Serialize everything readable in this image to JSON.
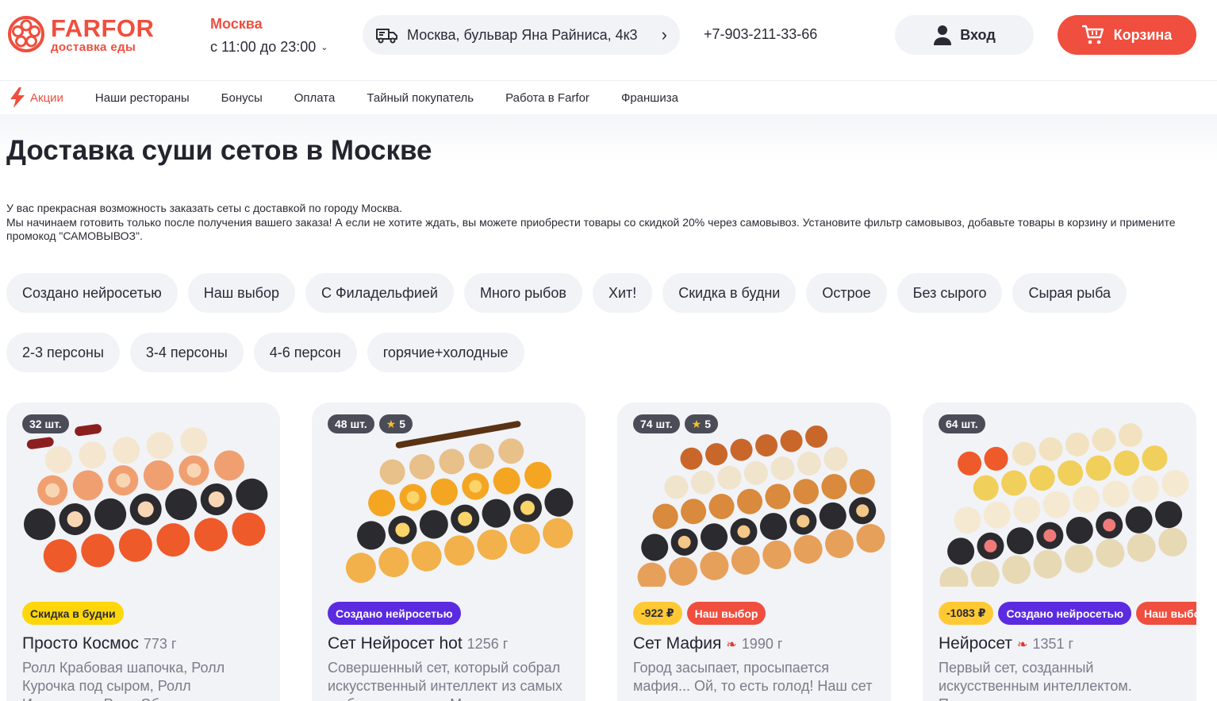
{
  "header": {
    "logo_name": "FARFOR",
    "logo_sub": "доставка еды",
    "city": "Москва",
    "hours": "с 11:00 до 23:00",
    "address": "Москва, бульвар Яна Райниса, 4к3",
    "phone": "+7-903-211-33-66",
    "login_label": "Вход",
    "cart_label": "Корзина",
    "accent_color": "#f04e3e"
  },
  "nav": {
    "items": [
      "Акции",
      "Наши рестораны",
      "Бонусы",
      "Оплата",
      "Тайный покупатель",
      "Работа в Farfor",
      "Франшиза"
    ]
  },
  "main": {
    "title": "Доставка суши сетов в Москве",
    "description_line1": "У вас прекрасная возможность заказать сеты с доставкой по городу Москва.",
    "description_line2": "Мы начинаем готовить только после получения вашего заказа! А если не хотите ждать, вы можете приобрести товары со скидкой 20% через самовывоз. Установите фильтр самовывоз, добавьте товары в корзину и примените промокод \"САМОВЫВОЗ\".",
    "filters_row1": [
      "Создано нейросетью",
      "Наш выбор",
      "С Филадельфией",
      "Много рыбов",
      "Хит!",
      "Скидка в будни",
      "Острое",
      "Без сырого",
      "Сырая рыба"
    ],
    "filters_row2": [
      "2-3 персоны",
      "3-4 персоны",
      "4-6 персон",
      "горячие+холодные"
    ]
  },
  "cards": [
    {
      "count": "32 шт.",
      "rating": "",
      "tags": [
        {
          "text": "Скидка в будни",
          "style": "yellow"
        }
      ],
      "name": "Просто Космос",
      "spicy": false,
      "weight": "773 г",
      "desc": "Ролл Крабовая шапочка, Ролл Курочка под сыром, Ролл Император, Ролл Эби шрим"
    },
    {
      "count": "48 шт.",
      "rating": "5",
      "tags": [
        {
          "text": "Создано нейросетью",
          "style": "purple"
        }
      ],
      "name": "Сет Нейросет hot",
      "spicy": false,
      "weight": "1256 г",
      "desc": "Совершенный сет, который собрал искусственный интеллект из самых любимых роллов. Мы"
    },
    {
      "count": "74 шт.",
      "rating": "5",
      "tags": [
        {
          "text": "-922 ₽",
          "style": "price"
        },
        {
          "text": "Наш выбор",
          "style": "red"
        }
      ],
      "name": "Сет Мафия",
      "spicy": true,
      "weight": "1990 г",
      "desc": "Город засыпает, просыпается мафия... Ой, то есть голод! Наш сет не оставит вам ни единого"
    },
    {
      "count": "64 шт.",
      "rating": "",
      "tags": [
        {
          "text": "-1083 ₽",
          "style": "price"
        },
        {
          "text": "Создано нейросетью",
          "style": "purple"
        },
        {
          "text": "Наш выбор",
          "style": "red"
        }
      ],
      "name": "Нейросет",
      "spicy": true,
      "weight": "1351 г",
      "desc": "Первый сет, созданный искусственным интеллектом. Проанализировав ваши"
    }
  ]
}
